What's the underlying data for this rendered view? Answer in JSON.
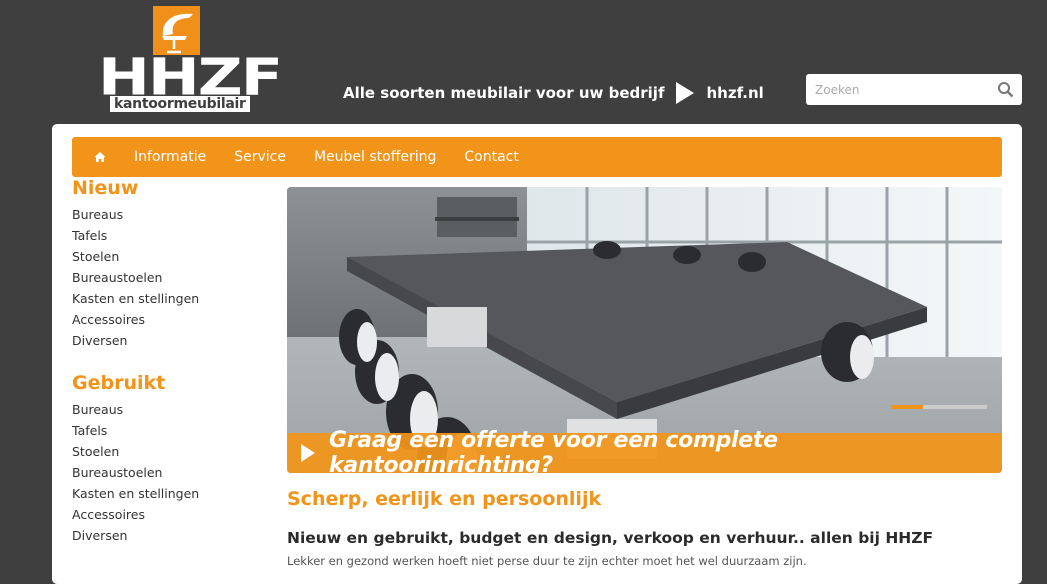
{
  "brand": {
    "logo_text": "HHZF",
    "logo_subtitle": "kantoormeubilair",
    "tagline": "Alle soorten meubilair voor uw bedrijf",
    "domain": "hhzf.nl",
    "accent_color": "#f29419"
  },
  "search": {
    "placeholder": "Zoeken",
    "icon": "search-icon"
  },
  "nav": {
    "home_icon": "home-icon",
    "items": [
      "Informatie",
      "Service",
      "Meubel stoffering",
      "Contact"
    ]
  },
  "sidebar": {
    "new": {
      "heading": "Nieuw",
      "items": [
        "Bureaus",
        "Tafels",
        "Stoelen",
        "Bureaustoelen",
        "Kasten en stellingen",
        "Accessoires",
        "Diversen"
      ]
    },
    "used": {
      "heading": "Gebruikt",
      "items": [
        "Bureaus",
        "Tafels",
        "Stoelen",
        "Bureaustoelen",
        "Kasten en stellingen",
        "Accessoires",
        "Diversen"
      ]
    }
  },
  "banner": {
    "caption": "Graag een offerte voor een complete kantoorinrichting?",
    "slider_progress": 0.33
  },
  "content": {
    "heading": "Scherp, eerlijk en persoonlijk",
    "subheading": "Nieuw en gebruikt, budget en design, verkoop en verhuur.. allen bij HHZF",
    "intro": "Lekker en gezond werken hoeft niet perse duur te zijn echter moet het wel duurzaam zijn."
  }
}
